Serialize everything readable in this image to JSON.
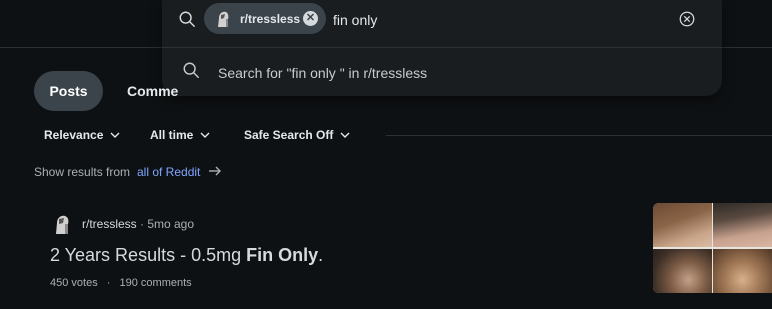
{
  "search": {
    "community_chip": "r/tressless",
    "query": "fin only",
    "suggestion": "Search for \"fin only \" in r/tressless"
  },
  "tabs": {
    "posts": "Posts",
    "comments": "Comme"
  },
  "filters": {
    "sort": "Relevance",
    "time": "All time",
    "safe_search": "Safe Search Off"
  },
  "scope": {
    "label": "Show results from",
    "link": "all of Reddit"
  },
  "post": {
    "subreddit": "r/tressless",
    "age": "· 5mo ago",
    "title_plain": "2 Years Results - 0.5mg ",
    "title_highlight": "Fin Only",
    "title_end": ".",
    "votes": "450 votes",
    "separator": "·",
    "comments": "190 comments"
  },
  "icons": {
    "search": "search-icon",
    "clear": "close-circle-icon",
    "chip_remove": "close-icon",
    "chevron": "chevron-down-icon",
    "arrow": "arrow-right-icon"
  },
  "colors": {
    "background": "#0e1113",
    "panel": "#1a1d20",
    "chip": "#3a444a",
    "link": "#7fa6ff"
  }
}
